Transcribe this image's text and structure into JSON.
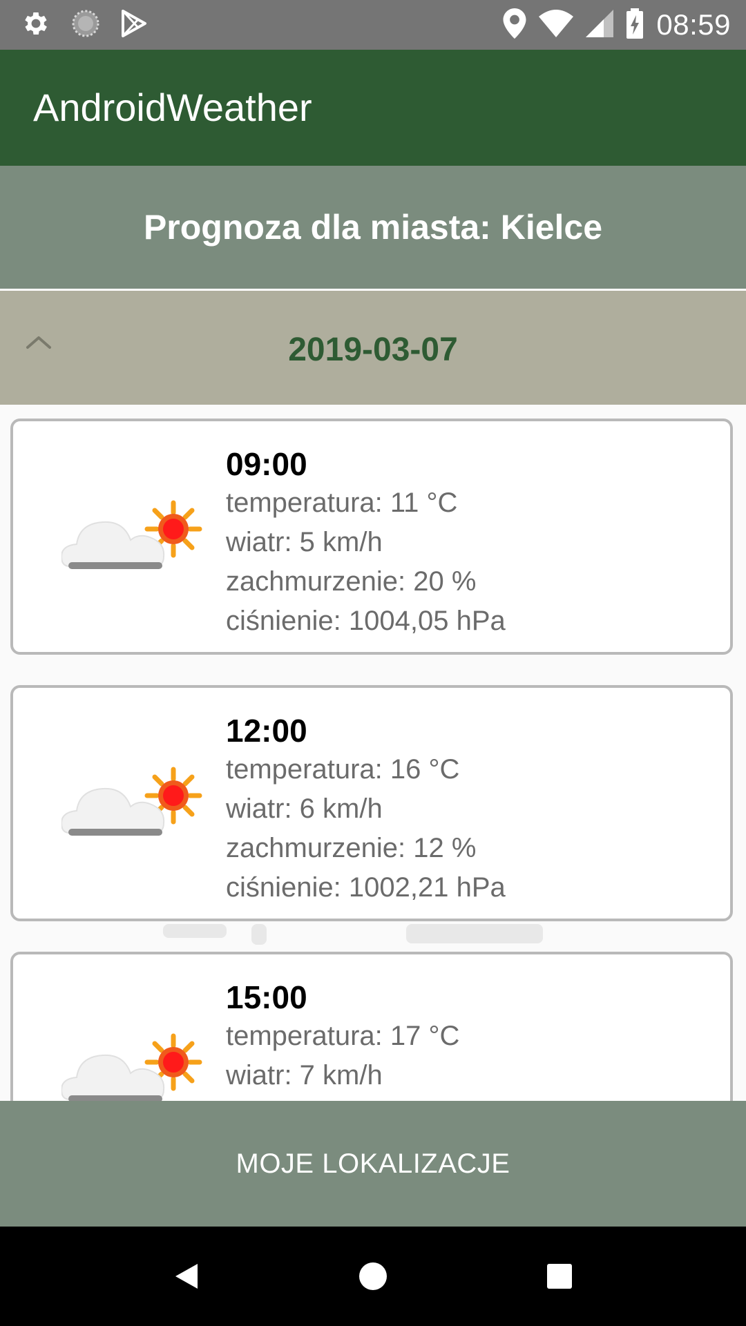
{
  "status_bar": {
    "time": "08:59",
    "left_icons": [
      "gear-icon",
      "sync-icon",
      "play-store-icon"
    ],
    "right_icons": [
      "location-icon",
      "wifi-icon",
      "cell-signal-icon",
      "battery-charging-icon"
    ]
  },
  "app_bar": {
    "title": "AndroidWeather"
  },
  "header": {
    "city_label": "Prognoza dla miasta: Kielce"
  },
  "day_group": {
    "date": "2019-03-07",
    "expanded": true,
    "chevron_icon": "chevron-up-icon"
  },
  "forecasts": [
    {
      "time": "09:00",
      "temperature": "temperatura: 11 °C",
      "wind": "wiatr: 5 km/h",
      "clouds": "zachmurzenie: 20 %",
      "pressure": "ciśnienie: 1004,05 hPa",
      "icon": "partly-cloudy-icon"
    },
    {
      "time": "12:00",
      "temperature": "temperatura: 16 °C",
      "wind": "wiatr: 6 km/h",
      "clouds": "zachmurzenie: 12 %",
      "pressure": "ciśnienie: 1002,21 hPa",
      "icon": "partly-cloudy-icon"
    },
    {
      "time": "15:00",
      "temperature": "temperatura: 17 °C",
      "wind": "wiatr: 7 km/h",
      "icon": "partly-cloudy-icon"
    }
  ],
  "bottom_button": {
    "label": "MOJE LOKALIZACJE"
  },
  "nav_bar": {
    "icons": [
      "back-icon",
      "home-icon",
      "recents-icon"
    ]
  },
  "colors": {
    "primary_dark": "#2e5b33",
    "header_bg": "#7b8c7e",
    "date_bg": "#afae9d",
    "status_bar": "#757575"
  }
}
